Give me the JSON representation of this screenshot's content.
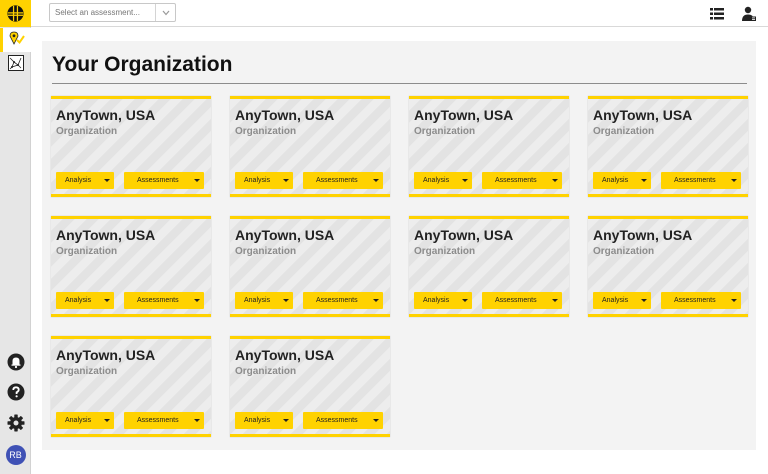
{
  "header": {
    "assessment_select": {
      "placeholder": "Select an assessment..."
    },
    "icons": [
      "logo-icon",
      "list-icon",
      "user-admin-icon"
    ]
  },
  "sidebar": {
    "items": [
      {
        "name": "map-pin-check-icon",
        "active": true
      },
      {
        "name": "network-map-icon",
        "active": false
      }
    ],
    "bottom": [
      "notifications-icon",
      "help-icon",
      "settings-icon"
    ],
    "avatar_initials": "RB"
  },
  "main": {
    "title": "Your Organization",
    "cards": [
      {
        "title": "AnyTown, USA",
        "subtitle": "Organization",
        "analysis_label": "Analysis",
        "assessments_label": "Assessments"
      },
      {
        "title": "AnyTown, USA",
        "subtitle": "Organization",
        "analysis_label": "Analysis",
        "assessments_label": "Assessments"
      },
      {
        "title": "AnyTown, USA",
        "subtitle": "Organization",
        "analysis_label": "Analysis",
        "assessments_label": "Assessments"
      },
      {
        "title": "AnyTown, USA",
        "subtitle": "Organization",
        "analysis_label": "Analysis",
        "assessments_label": "Assessments"
      },
      {
        "title": "AnyTown, USA",
        "subtitle": "Organization",
        "analysis_label": "Analysis",
        "assessments_label": "Assessments"
      },
      {
        "title": "AnyTown, USA",
        "subtitle": "Organization",
        "analysis_label": "Analysis",
        "assessments_label": "Assessments"
      },
      {
        "title": "AnyTown, USA",
        "subtitle": "Organization",
        "analysis_label": "Analysis",
        "assessments_label": "Assessments"
      },
      {
        "title": "AnyTown, USA",
        "subtitle": "Organization",
        "analysis_label": "Analysis",
        "assessments_label": "Assessments"
      },
      {
        "title": "AnyTown, USA",
        "subtitle": "Organization",
        "analysis_label": "Analysis",
        "assessments_label": "Assessments"
      },
      {
        "title": "AnyTown, USA",
        "subtitle": "Organization",
        "analysis_label": "Analysis",
        "assessments_label": "Assessments"
      }
    ]
  },
  "colors": {
    "accent": "#ffd200",
    "avatar": "#3f51b5"
  }
}
